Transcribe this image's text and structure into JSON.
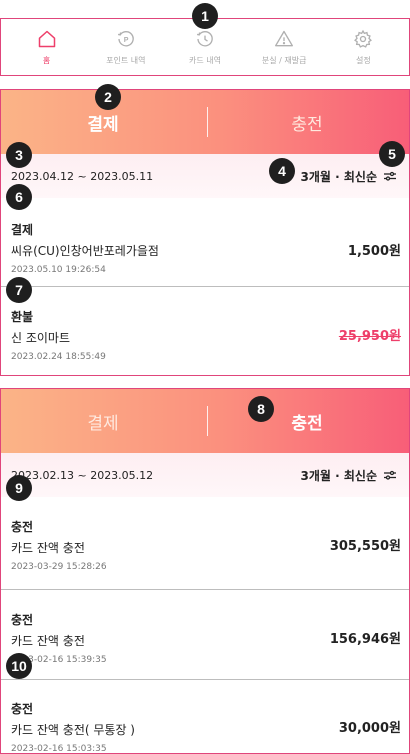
{
  "badges": [
    "1",
    "2",
    "3",
    "4",
    "5",
    "6",
    "7",
    "8",
    "9",
    "10"
  ],
  "nav": [
    {
      "label": "홈",
      "icon": "home-icon",
      "active": true
    },
    {
      "label": "포인트 내역",
      "icon": "point-history-icon",
      "active": false
    },
    {
      "label": "카드 내역",
      "icon": "card-history-icon",
      "active": false
    },
    {
      "label": "분실 / 재발급",
      "icon": "warning-icon",
      "active": false
    },
    {
      "label": "설정",
      "icon": "gear-icon",
      "active": false
    }
  ],
  "panel1": {
    "tabs": [
      "결제",
      "충전"
    ],
    "active_tab": "결제",
    "date_range": "2023.04.12 ~ 2023.05.11",
    "sort": "3개월 · 최신순",
    "transactions": [
      {
        "type": "결제",
        "merchant": "씨유(CU)인창어반포레가을점",
        "time": "2023.05.10 19:26:54",
        "amount": "1,500원",
        "cancelled": false
      },
      {
        "type": "환불",
        "merchant": "신 조이마트",
        "time": "2023.02.24 18:55:49",
        "amount": "25,950원",
        "cancelled": true
      }
    ]
  },
  "panel2": {
    "tabs": [
      "결제",
      "충전"
    ],
    "active_tab": "충전",
    "date_range": "2023.02.13 ~ 2023.05.12",
    "sort": "3개월 · 최신순",
    "transactions": [
      {
        "type": "충전",
        "merchant": "카드 잔액 충전",
        "time": "2023-03-29 15:28:26",
        "amount": "305,550원",
        "cancelled": false
      },
      {
        "type": "충전",
        "merchant": "카드 잔액 충전",
        "time": "2023-02-16 15:39:35",
        "amount": "156,946원",
        "cancelled": false
      },
      {
        "type": "충전",
        "merchant": "카드 잔액 충전( 무통장 )",
        "time": "2023-02-16 15:03:35",
        "amount": "30,000원",
        "cancelled": false
      }
    ]
  },
  "colors": {
    "accent": "#ee3f6a",
    "border": "#e0457b",
    "gradient_start": "#fbb487",
    "gradient_end": "#f85e78"
  }
}
